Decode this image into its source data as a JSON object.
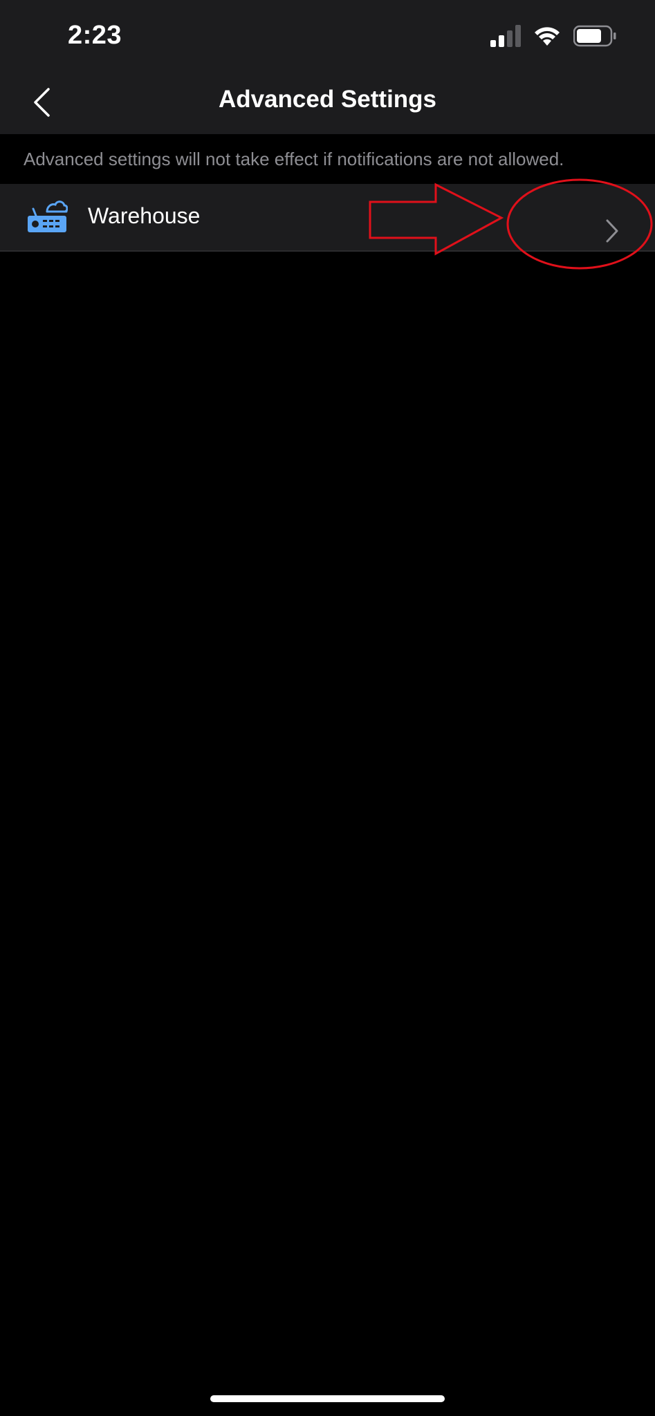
{
  "status_bar": {
    "time": "2:23",
    "signal_icon": "cellular-signal-icon",
    "wifi_icon": "wifi-icon",
    "battery_icon": "battery-icon",
    "battery_level": 0.75
  },
  "nav": {
    "title": "Advanced Settings",
    "back_icon": "chevron-left-icon"
  },
  "notice_text": "Advanced settings will not take effect if notifications are not allowed.",
  "devices": [
    {
      "label": "Warehouse",
      "icon": "cloud-recorder-icon",
      "chevron_icon": "chevron-right-icon"
    }
  ],
  "colors": {
    "background": "#000000",
    "bar_background": "#1c1c1e",
    "accent_blue": "#5aa5f5",
    "annotation_red": "#e0101a",
    "secondary_text": "#8e8e93"
  }
}
